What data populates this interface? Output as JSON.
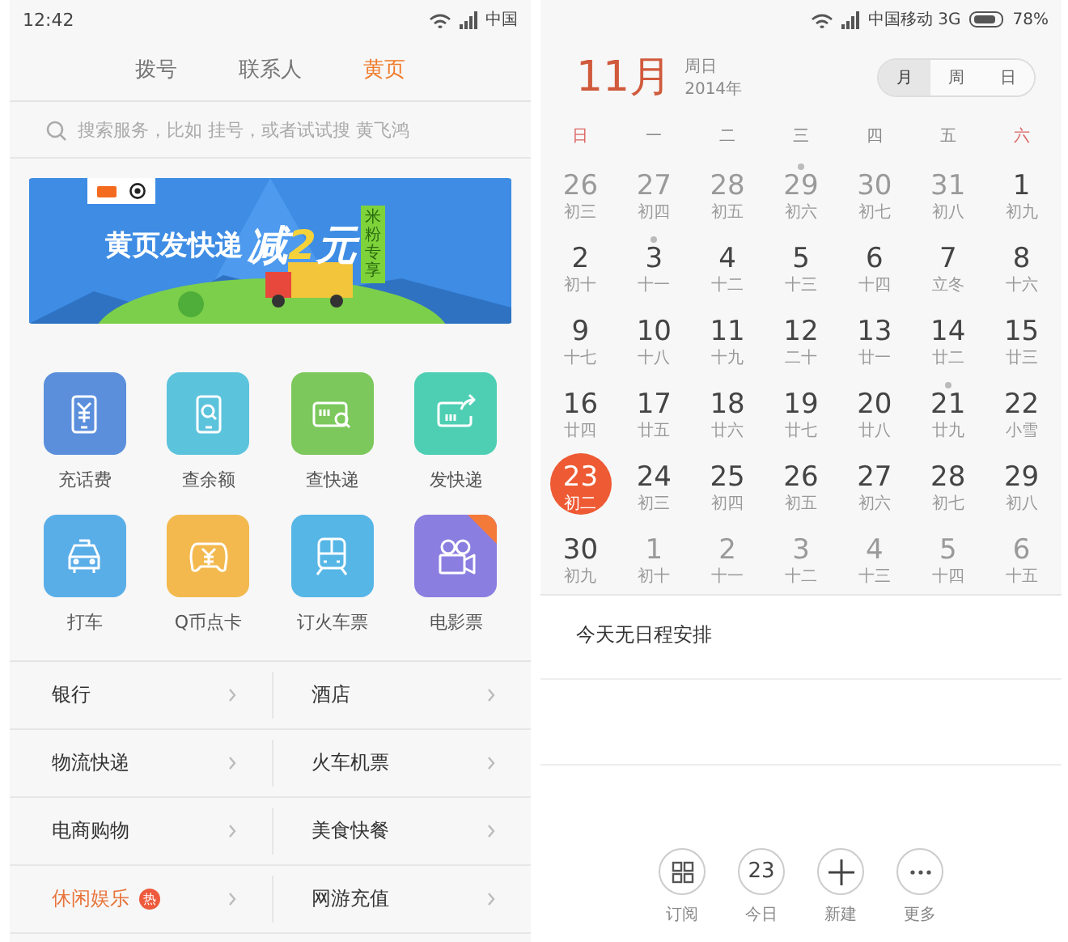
{
  "left_phone": {
    "status_bar": {
      "time": "12:42",
      "carrier": "中国"
    },
    "tabs": [
      {
        "label": "拨号",
        "selected": false
      },
      {
        "label": "联系人",
        "selected": false
      },
      {
        "label": "黄页",
        "selected": true
      }
    ],
    "search": {
      "placeholder": "搜索服务，比如 挂号，或者试试搜 黄飞鸿"
    },
    "banner": {
      "headline": "黄页发快递",
      "promo_text": "减",
      "promo_amount": "2",
      "promo_unit": "元",
      "tag": "米粉专享"
    },
    "services": [
      {
        "label": "充话费",
        "color": "#5b8fdc",
        "corner_badge": false
      },
      {
        "label": "查余额",
        "color": "#5cc3dc",
        "corner_badge": false
      },
      {
        "label": "查快递",
        "color": "#7cc85c",
        "corner_badge": false
      },
      {
        "label": "发快递",
        "color": "#4ecfb3",
        "corner_badge": false
      },
      {
        "label": "打车",
        "color": "#5aaee8",
        "corner_badge": false
      },
      {
        "label": "Q币点卡",
        "color": "#f3b94e",
        "corner_badge": false
      },
      {
        "label": "订火车票",
        "color": "#56b6e6",
        "corner_badge": false
      },
      {
        "label": "电影票",
        "color": "#8a7ee0",
        "corner_badge": true
      }
    ],
    "categories": [
      [
        {
          "label": "银行",
          "highlighted": false
        },
        {
          "label": "酒店",
          "highlighted": false
        }
      ],
      [
        {
          "label": "物流快递",
          "highlighted": false
        },
        {
          "label": "火车机票",
          "highlighted": false
        }
      ],
      [
        {
          "label": "电商购物",
          "highlighted": false
        },
        {
          "label": "美食快餐",
          "highlighted": false
        }
      ],
      [
        {
          "label": "休闲娱乐",
          "highlighted": true,
          "badge": "热"
        },
        {
          "label": "网游充值",
          "highlighted": false
        }
      ]
    ]
  },
  "right_phone": {
    "status_bar": {
      "carrier": "中国移动 3G",
      "battery": "78%"
    },
    "header": {
      "month": "11月",
      "weekday": "周日",
      "year": "2014年"
    },
    "view_switch": [
      {
        "label": "月",
        "selected": true
      },
      {
        "label": "周",
        "selected": false
      },
      {
        "label": "日",
        "selected": false
      }
    ],
    "weekdays": [
      {
        "label": "日",
        "weekend": true
      },
      {
        "label": "一",
        "weekend": false
      },
      {
        "label": "二",
        "weekend": false
      },
      {
        "label": "三",
        "weekend": false
      },
      {
        "label": "四",
        "weekend": false
      },
      {
        "label": "五",
        "weekend": false
      },
      {
        "label": "六",
        "weekend": true
      }
    ],
    "weeks": [
      [
        {
          "day": "26",
          "lunar": "初三",
          "other_month": true,
          "dot": false,
          "selected": false
        },
        {
          "day": "27",
          "lunar": "初四",
          "other_month": true,
          "dot": false,
          "selected": false
        },
        {
          "day": "28",
          "lunar": "初五",
          "other_month": true,
          "dot": false,
          "selected": false
        },
        {
          "day": "29",
          "lunar": "初六",
          "other_month": true,
          "dot": true,
          "selected": false
        },
        {
          "day": "30",
          "lunar": "初七",
          "other_month": true,
          "dot": false,
          "selected": false
        },
        {
          "day": "31",
          "lunar": "初八",
          "other_month": true,
          "dot": false,
          "selected": false
        },
        {
          "day": "1",
          "lunar": "初九",
          "other_month": false,
          "dot": false,
          "selected": false
        }
      ],
      [
        {
          "day": "2",
          "lunar": "初十",
          "other_month": false,
          "dot": false,
          "selected": false
        },
        {
          "day": "3",
          "lunar": "十一",
          "other_month": false,
          "dot": true,
          "selected": false
        },
        {
          "day": "4",
          "lunar": "十二",
          "other_month": false,
          "dot": false,
          "selected": false
        },
        {
          "day": "5",
          "lunar": "十三",
          "other_month": false,
          "dot": false,
          "selected": false
        },
        {
          "day": "6",
          "lunar": "十四",
          "other_month": false,
          "dot": false,
          "selected": false
        },
        {
          "day": "7",
          "lunar": "立冬",
          "other_month": false,
          "dot": false,
          "selected": false
        },
        {
          "day": "8",
          "lunar": "十六",
          "other_month": false,
          "dot": false,
          "selected": false
        }
      ],
      [
        {
          "day": "9",
          "lunar": "十七",
          "other_month": false,
          "dot": false,
          "selected": false
        },
        {
          "day": "10",
          "lunar": "十八",
          "other_month": false,
          "dot": false,
          "selected": false
        },
        {
          "day": "11",
          "lunar": "十九",
          "other_month": false,
          "dot": false,
          "selected": false
        },
        {
          "day": "12",
          "lunar": "二十",
          "other_month": false,
          "dot": false,
          "selected": false
        },
        {
          "day": "13",
          "lunar": "廿一",
          "other_month": false,
          "dot": false,
          "selected": false
        },
        {
          "day": "14",
          "lunar": "廿二",
          "other_month": false,
          "dot": false,
          "selected": false
        },
        {
          "day": "15",
          "lunar": "廿三",
          "other_month": false,
          "dot": false,
          "selected": false
        }
      ],
      [
        {
          "day": "16",
          "lunar": "廿四",
          "other_month": false,
          "dot": false,
          "selected": false
        },
        {
          "day": "17",
          "lunar": "廿五",
          "other_month": false,
          "dot": false,
          "selected": false
        },
        {
          "day": "18",
          "lunar": "廿六",
          "other_month": false,
          "dot": false,
          "selected": false
        },
        {
          "day": "19",
          "lunar": "廿七",
          "other_month": false,
          "dot": false,
          "selected": false
        },
        {
          "day": "20",
          "lunar": "廿八",
          "other_month": false,
          "dot": false,
          "selected": false
        },
        {
          "day": "21",
          "lunar": "廿九",
          "other_month": false,
          "dot": true,
          "selected": false
        },
        {
          "day": "22",
          "lunar": "小雪",
          "other_month": false,
          "dot": false,
          "selected": false
        }
      ],
      [
        {
          "day": "23",
          "lunar": "初二",
          "other_month": false,
          "dot": false,
          "selected": true
        },
        {
          "day": "24",
          "lunar": "初三",
          "other_month": false,
          "dot": false,
          "selected": false
        },
        {
          "day": "25",
          "lunar": "初四",
          "other_month": false,
          "dot": false,
          "selected": false
        },
        {
          "day": "26",
          "lunar": "初五",
          "other_month": false,
          "dot": false,
          "selected": false
        },
        {
          "day": "27",
          "lunar": "初六",
          "other_month": false,
          "dot": false,
          "selected": false
        },
        {
          "day": "28",
          "lunar": "初七",
          "other_month": false,
          "dot": false,
          "selected": false
        },
        {
          "day": "29",
          "lunar": "初八",
          "other_month": false,
          "dot": false,
          "selected": false
        }
      ],
      [
        {
          "day": "30",
          "lunar": "初九",
          "other_month": false,
          "dot": false,
          "selected": false
        },
        {
          "day": "1",
          "lunar": "初十",
          "other_month": true,
          "dot": false,
          "selected": false
        },
        {
          "day": "2",
          "lunar": "十一",
          "other_month": true,
          "dot": false,
          "selected": false
        },
        {
          "day": "3",
          "lunar": "十二",
          "other_month": true,
          "dot": false,
          "selected": false
        },
        {
          "day": "4",
          "lunar": "十三",
          "other_month": true,
          "dot": false,
          "selected": false
        },
        {
          "day": "5",
          "lunar": "十四",
          "other_month": true,
          "dot": false,
          "selected": false
        },
        {
          "day": "6",
          "lunar": "十五",
          "other_month": true,
          "dot": false,
          "selected": false
        }
      ]
    ],
    "agenda": {
      "empty_message": "今天无日程安排"
    },
    "actions": [
      {
        "kind": "grid",
        "label": "订阅"
      },
      {
        "kind": "text",
        "text": "23",
        "label": "今日"
      },
      {
        "kind": "plus",
        "label": "新建"
      },
      {
        "kind": "more",
        "label": "更多"
      }
    ]
  }
}
